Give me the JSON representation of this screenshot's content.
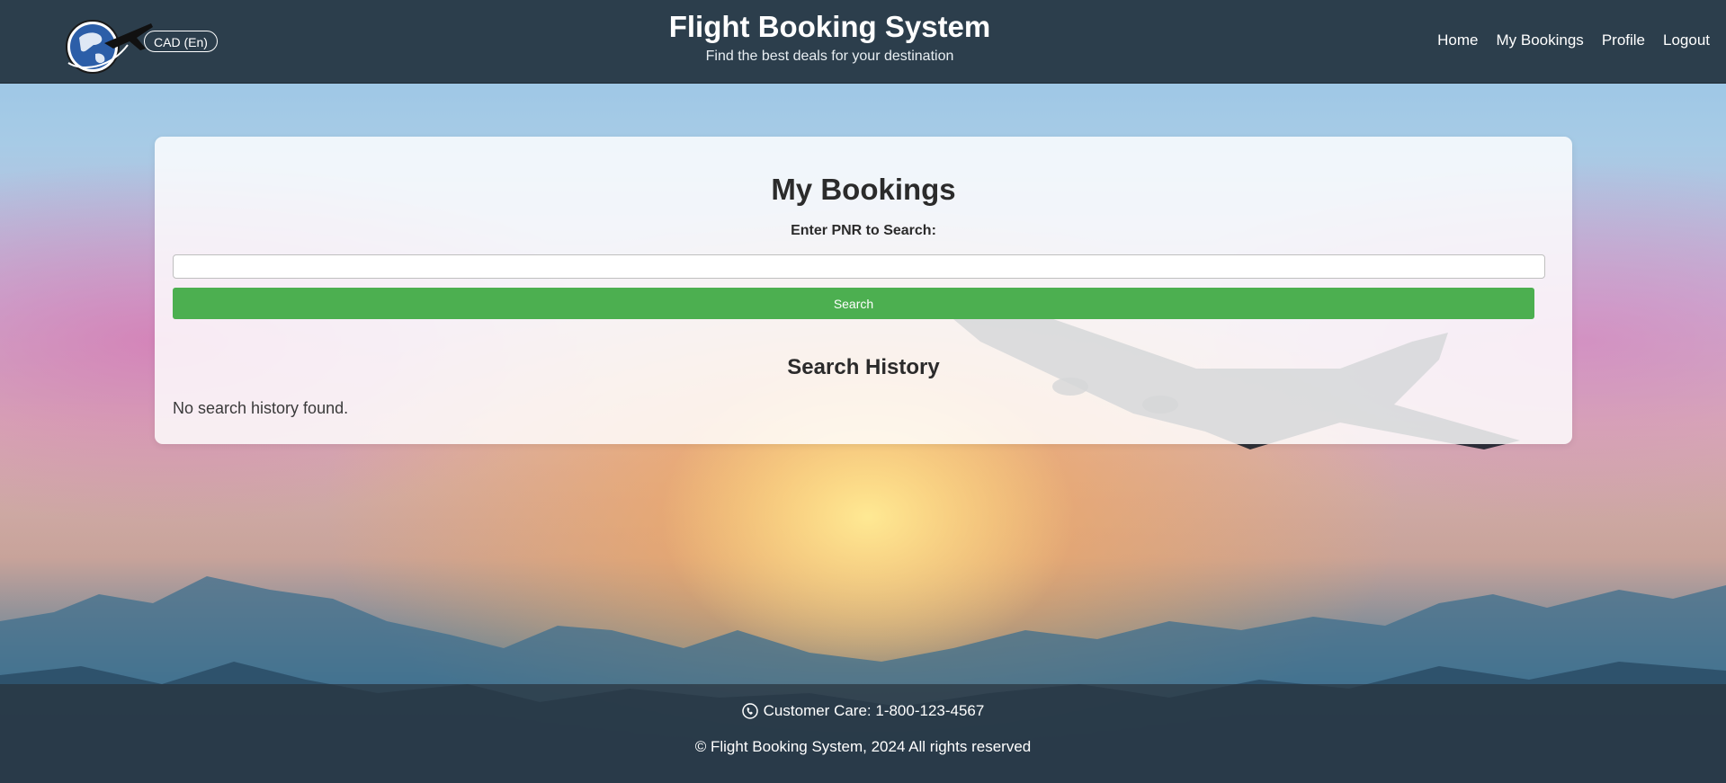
{
  "header": {
    "currency": "CAD (En)",
    "title": "Flight Booking System",
    "subtitle": "Find the best deals for your destination",
    "nav": [
      "Home",
      "My Bookings",
      "Profile",
      "Logout"
    ]
  },
  "main": {
    "heading": "My Bookings",
    "pnr_label": "Enter PNR to Search:",
    "pnr_value": "",
    "search_button": "Search",
    "history_heading": "Search History",
    "history_empty": "No search history found."
  },
  "footer": {
    "care": "Customer Care: 1-800-123-4567",
    "copyright": "© Flight Booking System, 2024 All rights reserved"
  },
  "colors": {
    "header_bg": "#2c3e4c",
    "accent_green": "#4caf50"
  }
}
